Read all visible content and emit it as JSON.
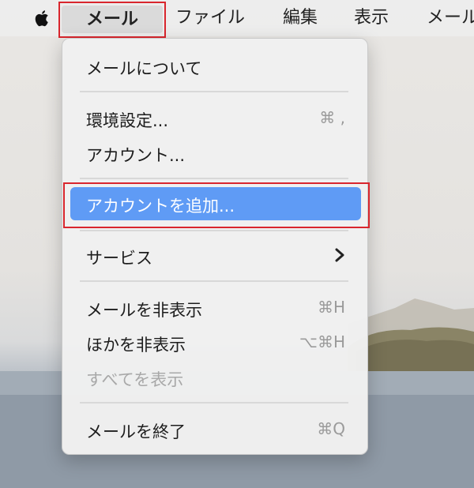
{
  "menubar": {
    "apple_icon": "apple-logo-icon",
    "items": [
      "メール",
      "ファイル",
      "編集",
      "表示",
      "メール"
    ]
  },
  "menu": {
    "items": [
      {
        "label": "メールについて",
        "shortcut": ""
      },
      {
        "label": "環境設定...",
        "shortcut": "⌘ ,"
      },
      {
        "label": "アカウント...",
        "shortcut": ""
      },
      {
        "label": "アカウントを追加...",
        "shortcut": ""
      },
      {
        "label": "サービス",
        "shortcut": ""
      },
      {
        "label": "メールを非表示",
        "shortcut": "⌘H"
      },
      {
        "label": "ほかを非表示",
        "shortcut": "⌥⌘H"
      },
      {
        "label": "すべてを表示",
        "shortcut": ""
      },
      {
        "label": "メールを終了",
        "shortcut": "⌘Q"
      }
    ]
  },
  "colors": {
    "highlight": "#5f9bf5",
    "annotation_border": "#d9262d"
  }
}
